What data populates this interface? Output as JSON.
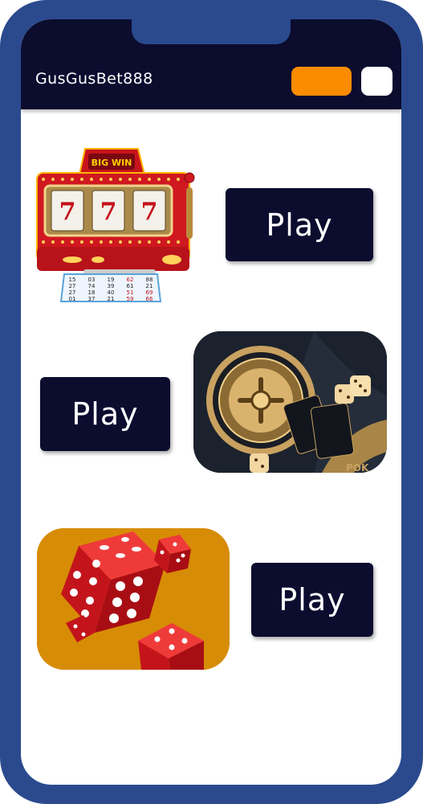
{
  "app": {
    "title": "GusGusBet888"
  },
  "header": {
    "brand": "GusGusBet888",
    "accent_color": "#fb8c00",
    "background_color": "#0b0c2e"
  },
  "games": [
    {
      "name": "slot-machine",
      "icon": "slot-machine-icon",
      "play_label": "Play"
    },
    {
      "name": "roulette-poker",
      "icon": "roulette-icon",
      "play_label": "Play"
    },
    {
      "name": "dice",
      "icon": "dice-icon",
      "play_label": "Play"
    }
  ],
  "slot_machine": {
    "banner": "BIG WIN",
    "reels": [
      "7",
      "7",
      "7"
    ],
    "ticket_rows": [
      [
        "15",
        "03",
        "19",
        "62",
        "88"
      ],
      [
        "27",
        "74",
        "39",
        "61",
        "21"
      ],
      [
        "27",
        "18",
        "40",
        "51",
        "69"
      ],
      [
        "01",
        "37",
        "21",
        "59",
        "66"
      ]
    ]
  },
  "roulette": {
    "corner_text": "POK"
  },
  "colors": {
    "frame": "#2b4a8e",
    "button": "#0b0c2e",
    "dice_tile": "#d78c05"
  }
}
